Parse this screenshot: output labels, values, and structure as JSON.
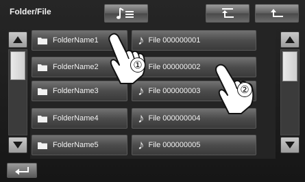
{
  "header": {
    "title": "Folder/File"
  },
  "folders": [
    {
      "label": "FolderName1"
    },
    {
      "label": "FolderName2"
    },
    {
      "label": "FolderName3"
    },
    {
      "label": "FolderName4"
    },
    {
      "label": "FolderName5"
    }
  ],
  "files": [
    {
      "label": "File 000000001"
    },
    {
      "label": "File 000000002"
    },
    {
      "label": "File 000000003"
    },
    {
      "label": "File 000000004"
    },
    {
      "label": "File 000000005"
    }
  ],
  "callouts": {
    "first": "①",
    "second": "②"
  },
  "icons": {
    "playlist": "music-list-icon",
    "up_root": "return-to-top-icon",
    "up_level": "return-up-icon",
    "scroll_up": "triangle-up-icon",
    "scroll_down": "triangle-down-icon",
    "back": "back-arrow-icon",
    "folder": "folder-icon",
    "file": "music-note-icon",
    "hand": "pointing-hand-icon"
  }
}
